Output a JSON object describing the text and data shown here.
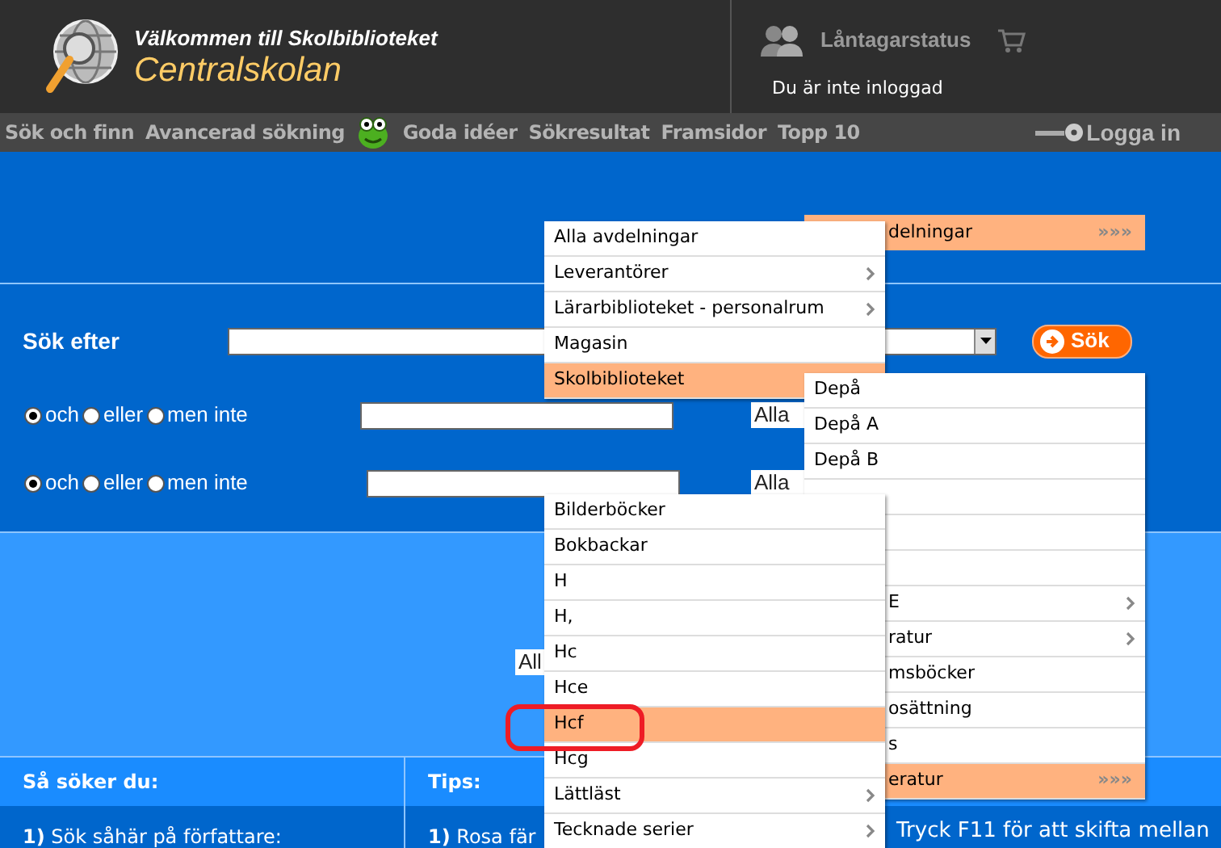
{
  "header": {
    "welcome": "Välkommen till Skolbiblioteket",
    "school": "Centralskolan",
    "borrower_status": "Låntagarstatus",
    "login_status": "Du är inte inloggad"
  },
  "nav": {
    "items": [
      "Sök och finn",
      "Avancerad sökning",
      "Goda idéer",
      "Sökresultat",
      "Framsidor",
      "Topp 10"
    ],
    "login": "Logga in"
  },
  "department_bar": {
    "label": "delningar",
    "arrows": "»»»"
  },
  "search": {
    "label": "Sök efter",
    "button": "Sök"
  },
  "rows": [
    {
      "operators": [
        {
          "label": "och",
          "selected": true
        },
        {
          "label": "eller",
          "selected": false
        },
        {
          "label": "men inte",
          "selected": false
        }
      ],
      "field_value": "Alla"
    },
    {
      "operators": [
        {
          "label": "och",
          "selected": true
        },
        {
          "label": "eller",
          "selected": false
        },
        {
          "label": "men inte",
          "selected": false
        }
      ],
      "field_value": "Alla"
    }
  ],
  "third_field_value": "All",
  "help": {
    "heading": "Så söker du:",
    "text": "**1)** Sök såhär på författare:"
  },
  "tips": {
    "heading": "Tips:",
    "text": "**1)** Rosa fär",
    "note": "Tryck F11 för att skifta mellan"
  },
  "menu_1": [
    {
      "label": "Alla avdelningar",
      "submenu": false,
      "selected": false
    },
    {
      "label": "Leverantörer",
      "submenu": true,
      "selected": false
    },
    {
      "label": "Lärarbiblioteket - personalrum",
      "submenu": true,
      "selected": false
    },
    {
      "label": "Magasin",
      "submenu": false,
      "selected": false
    },
    {
      "label": "Skolbiblioteket",
      "submenu": false,
      "selected": true
    }
  ],
  "menu_2": [
    {
      "kind": "full",
      "label": "Depå",
      "submenu": false,
      "selected": false
    },
    {
      "kind": "full",
      "label": "Depå A",
      "submenu": false,
      "selected": false
    },
    {
      "kind": "full",
      "label": "Depå B",
      "submenu": false,
      "selected": false
    },
    {
      "kind": "covered",
      "selected": false
    },
    {
      "kind": "covered",
      "selected": false
    },
    {
      "kind": "covered",
      "selected": false
    },
    {
      "kind": "cut",
      "label": "E",
      "submenu": true,
      "selected": false
    },
    {
      "kind": "cut",
      "label": "ratur",
      "submenu": true,
      "selected": false
    },
    {
      "kind": "cut",
      "label": "msböcker",
      "submenu": false,
      "selected": false
    },
    {
      "kind": "cut",
      "label": "osättning",
      "submenu": false,
      "selected": false
    },
    {
      "kind": "cut",
      "label": "s",
      "submenu": false,
      "selected": false
    },
    {
      "kind": "cut",
      "label": "eratur",
      "selected": true,
      "arrows": "»»»"
    }
  ],
  "menu_3": [
    {
      "label": "Bilderböcker",
      "submenu": false,
      "selected": false
    },
    {
      "label": "Bokbackar",
      "submenu": false,
      "selected": false
    },
    {
      "label": "H",
      "submenu": false,
      "selected": false
    },
    {
      "label": "H,",
      "submenu": false,
      "selected": false
    },
    {
      "label": "Hc",
      "submenu": false,
      "selected": false
    },
    {
      "label": "Hce",
      "submenu": false,
      "selected": false
    },
    {
      "label": "Hcf",
      "submenu": false,
      "selected": true
    },
    {
      "label": "Hcg",
      "submenu": false,
      "selected": false
    },
    {
      "label": "Lättläst",
      "submenu": true,
      "selected": false
    },
    {
      "label": "Tecknade serier",
      "submenu": true,
      "selected": false
    }
  ]
}
